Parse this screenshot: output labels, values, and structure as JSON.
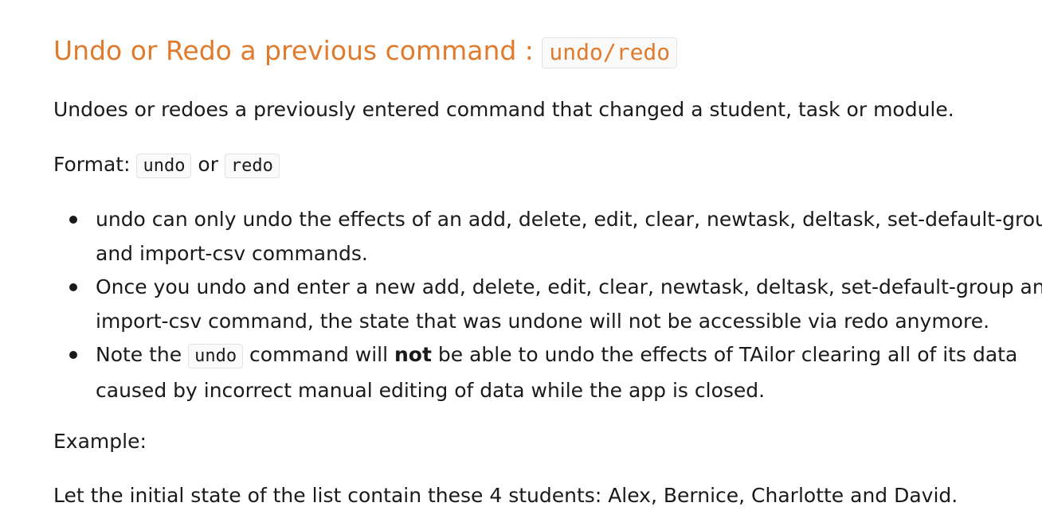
{
  "heading": {
    "text": "Undo or Redo a previous command : ",
    "code": "undo/redo"
  },
  "description": "Undoes or redoes a previously entered command that changed a student, task or module.",
  "format": {
    "label": "Format: ",
    "code_undo": "undo",
    "or": " or ",
    "code_redo": "redo"
  },
  "notes": [
    {
      "text": "undo can only undo the effects of an add, delete, edit, clear, newtask, deltask, set-default-group and import-csv commands."
    },
    {
      "text": "Once you undo and enter a new add, delete, edit, clear, newtask, deltask, set-default-group and import-csv command, the state that was undone will not be accessible via redo anymore."
    },
    {
      "prefix": "Note the ",
      "code": "undo",
      "mid": " command will ",
      "bold": "not",
      "suffix": " be able to undo the effects of TAilor clearing all of its data caused by incorrect manual editing of data while the app is closed."
    }
  ],
  "example_label": "Example:",
  "example_intro": "Let the initial state of the list contain these 4 students: Alex, Bernice, Charlotte and David.",
  "colors": {
    "heading": "#e07a2c",
    "text": "#1a1a1a",
    "code_bg": "#fafafa",
    "code_border": "#e3e3e3"
  }
}
